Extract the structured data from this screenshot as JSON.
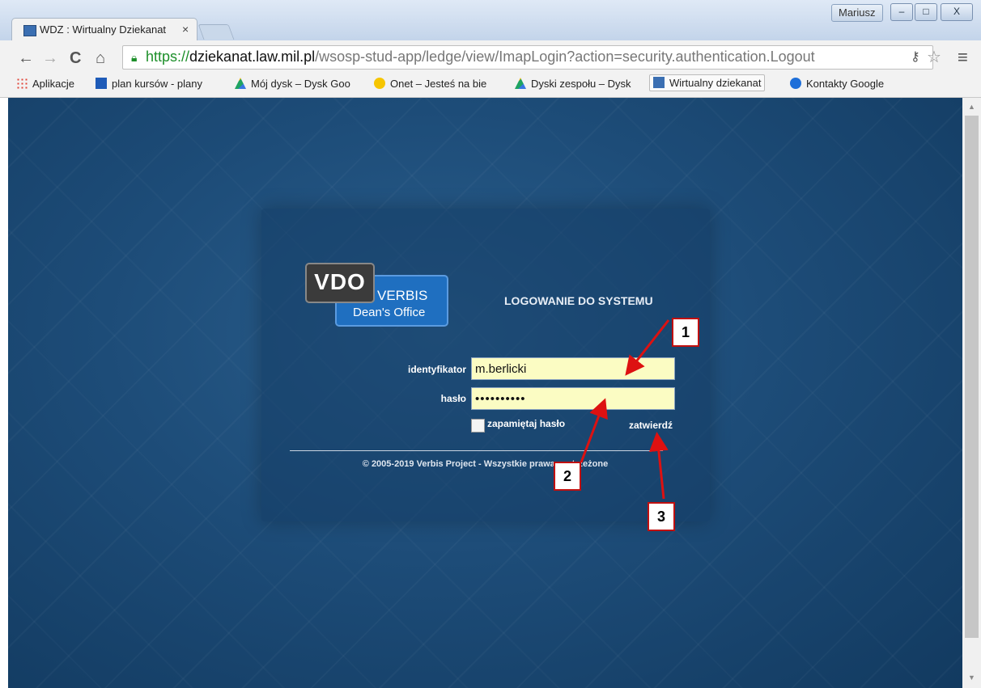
{
  "window": {
    "profile": "Mariusz",
    "min": "–",
    "max": "□",
    "close": "X"
  },
  "tab": {
    "title": "WDZ : Wirtualny Dziekanat",
    "close": "×"
  },
  "toolbar": {
    "url_scheme": "https://",
    "url_host": "dziekanat.law.mil.pl",
    "url_path": "/wsosp-stud-app/ledge/view/ImapLogin?action=security.authentication.Logout"
  },
  "bookmarks": [
    {
      "label": "Aplikacje",
      "icon": "apps-icon",
      "color": "#e0463a"
    },
    {
      "label": "plan kursów - plany",
      "icon": "calendar-icon",
      "color": "#1e5bb8"
    },
    {
      "label": "Mój dysk – Dysk Goo",
      "icon": "drive-icon",
      "color": "#f2b300"
    },
    {
      "label": "Onet – Jesteś na bie",
      "icon": "onet-icon",
      "color": "#f6c500"
    },
    {
      "label": "Dyski zespołu – Dysk",
      "icon": "drive-icon",
      "color": "#f2b300"
    },
    {
      "label": "Wirtualny dziekanat",
      "icon": "wdz-icon",
      "color": "#3b6fb2"
    },
    {
      "label": "Kontakty Google",
      "icon": "contacts-icon",
      "color": "#1e6fd9"
    }
  ],
  "logo": {
    "vdo": "VDO",
    "verbis": "VERBIS",
    "office": "Dean's Office"
  },
  "login": {
    "heading": "LOGOWANIE DO SYSTEMU",
    "id_label": "identyfikator",
    "id_value": "m.berlicki",
    "pass_label": "hasło",
    "pass_value": "••••••••••",
    "remember_label": "zapamiętaj hasło",
    "submit_label": "zatwierdź"
  },
  "footer": {
    "copyright": "© 2005-2019 Verbis Project - Wszystkie prawa zastrzeżone"
  },
  "annotations": [
    "1",
    "2",
    "3"
  ]
}
